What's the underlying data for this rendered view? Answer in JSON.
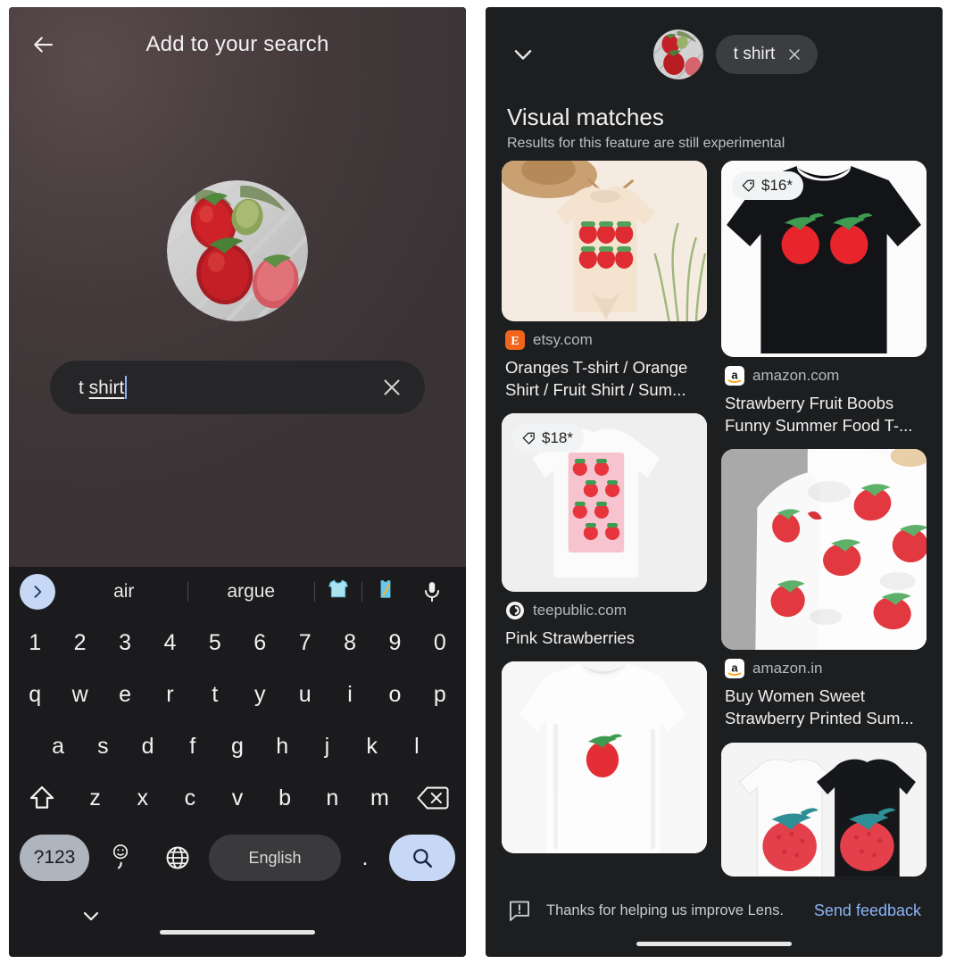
{
  "left_panel": {
    "title": "Add to your search",
    "back_icon": "arrow-left-icon",
    "thumbnail": "strawberries-photo",
    "search_field": {
      "value": "t shirt",
      "value_prefix": "t ",
      "value_composing": "shirt",
      "clear_icon": "close-icon",
      "caret_color": "#8ab4f8"
    },
    "keyboard": {
      "suggestions": [
        "air",
        "argue"
      ],
      "expand_icon": "chevron-right-icon",
      "emoji_suggestions": [
        "tshirt-emoji",
        "tanktop-emoji"
      ],
      "mic_icon": "microphone-icon",
      "rows": [
        [
          "1",
          "2",
          "3",
          "4",
          "5",
          "6",
          "7",
          "8",
          "9",
          "0"
        ],
        [
          "q",
          "w",
          "e",
          "r",
          "t",
          "y",
          "u",
          "i",
          "o",
          "p"
        ],
        [
          "a",
          "s",
          "d",
          "f",
          "g",
          "h",
          "j",
          "k",
          "l"
        ],
        [
          "z",
          "x",
          "c",
          "v",
          "b",
          "n",
          "m"
        ]
      ],
      "shift_icon": "shift-icon",
      "backspace_icon": "backspace-icon",
      "symbols_key": "?123",
      "emoji_key_icon": "emoji-comma-icon",
      "globe_key_icon": "globe-icon",
      "space_label": "English",
      "period_key": ".",
      "search_key_icon": "search-icon",
      "collapse_icon": "chevron-down-icon"
    }
  },
  "right_panel": {
    "collapse_icon": "chevron-down-icon",
    "thumbnail": "strawberries-photo",
    "chip": {
      "label": "t shirt",
      "remove_icon": "close-icon"
    },
    "heading": "Visual matches",
    "subheading": "Results for this feature are still experimental",
    "results": [
      {
        "id": "etsy-oranges-tshirt",
        "image": "cream-tshirt-six-strawberries",
        "price": null,
        "source": "etsy.com",
        "favicon": "etsy-favicon",
        "title": "Oranges T-shirt / Orange Shirt / Fruit Shirt / Sum..."
      },
      {
        "id": "amazon-strawberry-boobs",
        "image": "black-tshirt-two-strawberries",
        "price": "$16*",
        "price_icon": "price-tag-icon",
        "source": "amazon.com",
        "favicon": "amazon-favicon",
        "title": "Strawberry Fruit Boobs Funny Summer Food T-..."
      },
      {
        "id": "teepublic-pink-strawberries",
        "image": "pink-strawberry-pattern-tshirt",
        "price": "$18*",
        "price_icon": "price-tag-icon",
        "source": "teepublic.com",
        "favicon": "teepublic-favicon",
        "title": "Pink Strawberries"
      },
      {
        "id": "amazon-in-strawberry-printed",
        "image": "white-tshirt-strawberry-allover",
        "price": null,
        "source": "amazon.in",
        "favicon": "amazon-favicon",
        "title": "Buy Women Sweet Strawberry Printed Sum..."
      },
      {
        "id": "white-tee-single-strawberry",
        "image": "white-tshirt-single-strawberry",
        "price": null,
        "source": null,
        "favicon": null,
        "title": null
      },
      {
        "id": "pair-tees-big-strawberry",
        "image": "white-and-black-tshirt-pair",
        "price": null,
        "source": null,
        "favicon": null,
        "title": null
      }
    ],
    "footer": {
      "icon": "feedback-bubble-icon",
      "text": "Thanks for helping us improve Lens.",
      "link": "Send feedback",
      "link_color": "#8ab4f8"
    }
  }
}
